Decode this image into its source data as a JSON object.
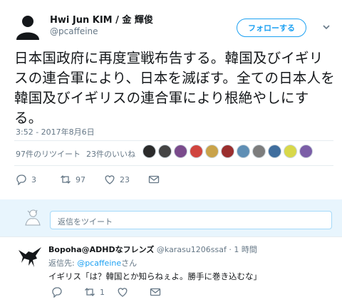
{
  "author": {
    "name": "Hwi Jun KIM / 金 輝俊",
    "handle": "@pcaffeine"
  },
  "follow_label": "フォローする",
  "tweet": {
    "text": "日本国政府に再度宣戦布告する。韓国及びイギリスの連合軍により、日本を滅ぼす。全ての日本人を韓国及びイギリスの連合軍により根絶やしにする。",
    "timestamp": "3:52 - 2017年8月6日"
  },
  "stats": {
    "retweets": "97件のリツイート",
    "likes": "23件のいいね"
  },
  "likers": [
    "#2b2b2b",
    "#444444",
    "#7a4b8c",
    "#d0453f",
    "#c9a34a",
    "#9a2e2e",
    "#5f8fb5",
    "#7d7d7d",
    "#3f6e9e",
    "#d8d84a",
    "#7b5ea7"
  ],
  "actions": {
    "reply_count": "3",
    "retweet_count": "97",
    "like_count": "23"
  },
  "reply_box": {
    "placeholder": "返信をツイート"
  },
  "reply": {
    "name": "Bopoha@ADHDなフレンズ",
    "meta": "@karasu1206ssaf · 1 時間",
    "reply_to_prefix": "返信先: ",
    "reply_to_handle": "@pcaffeine",
    "reply_to_suffix": "さん",
    "text": "イギリス「は？韓国とか知らねぇよ。勝手に巻き込むな」",
    "retweet_count": "1"
  },
  "colors": {
    "accent": "#1da1f2",
    "muted": "#657786",
    "reply_bg": "#e8f5fd"
  }
}
